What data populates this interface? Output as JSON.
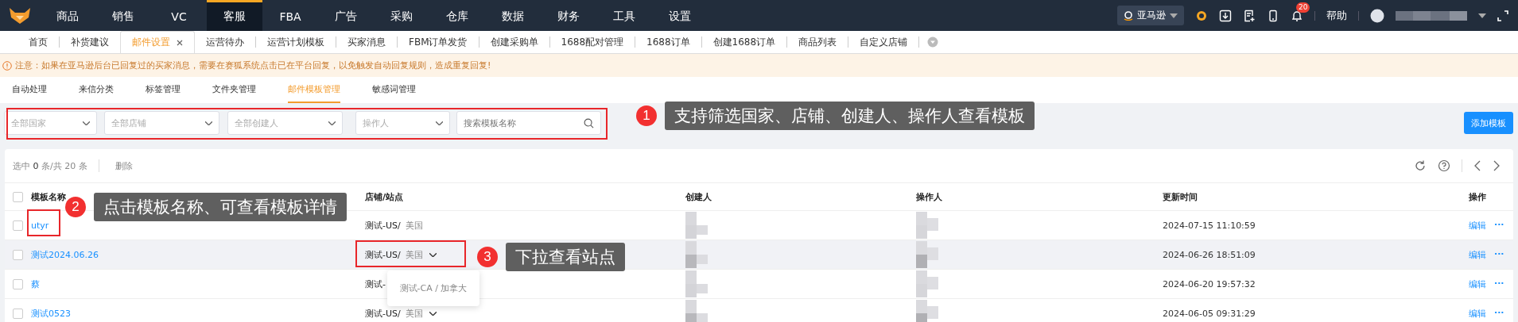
{
  "top_nav": {
    "items": [
      {
        "label": "商品",
        "selected": false
      },
      {
        "label": "销售",
        "selected": false
      },
      {
        "label": "VC",
        "selected": false
      },
      {
        "label": "客服",
        "selected": true
      },
      {
        "label": "FBA",
        "selected": false
      },
      {
        "label": "广告",
        "selected": false
      },
      {
        "label": "采购",
        "selected": false
      },
      {
        "label": "仓库",
        "selected": false
      },
      {
        "label": "数据",
        "selected": false
      },
      {
        "label": "财务",
        "selected": false
      },
      {
        "label": "工具",
        "selected": false
      },
      {
        "label": "设置",
        "selected": false
      }
    ],
    "platform": "亚马逊",
    "badge": "20",
    "help": "帮助"
  },
  "tabs": [
    {
      "label": "首页",
      "selected": false
    },
    {
      "label": "补货建议",
      "selected": false
    },
    {
      "label": "邮件设置",
      "selected": true
    },
    {
      "label": "运营待办",
      "selected": false
    },
    {
      "label": "运营计划模板",
      "selected": false
    },
    {
      "label": "买家消息",
      "selected": false
    },
    {
      "label": "FBM订单发货",
      "selected": false
    },
    {
      "label": "创建采购单",
      "selected": false
    },
    {
      "label": "1688配对管理",
      "selected": false
    },
    {
      "label": "1688订单",
      "selected": false
    },
    {
      "label": "创建1688订单",
      "selected": false
    },
    {
      "label": "商品列表",
      "selected": false
    },
    {
      "label": "自定义店铺",
      "selected": false
    }
  ],
  "notice": "注意：如果在亚马逊后台已回复过的买家消息，需要在赛狐系统点击已在平台回复，以免触发自动回复规则，造成重复回复!",
  "sub_tabs": [
    {
      "label": "自动处理",
      "selected": false
    },
    {
      "label": "来信分类",
      "selected": false
    },
    {
      "label": "标签管理",
      "selected": false
    },
    {
      "label": "文件夹管理",
      "selected": false
    },
    {
      "label": "邮件模板管理",
      "selected": true
    },
    {
      "label": "敏感词管理",
      "selected": false
    }
  ],
  "filters": [
    {
      "placeholder": "全部国家"
    },
    {
      "placeholder": "全部店铺"
    },
    {
      "placeholder": "全部创建人"
    },
    {
      "placeholder": "操作人"
    }
  ],
  "search": {
    "placeholder": "搜索模板名称"
  },
  "add_button": "添加模板",
  "toolbar": {
    "selected_prefix": "选中",
    "selected_count": "0",
    "selected_mid": "条/共",
    "total": "20",
    "selected_suffix": "条",
    "delete": "删除"
  },
  "table": {
    "all_checked": false,
    "columns": [
      "模板名称",
      "店铺/站点",
      "创建人",
      "操作人",
      "更新时间",
      "操作"
    ],
    "rows": [
      {
        "name": "utyr",
        "store": "测试-US",
        "sep": "/",
        "site": "美国",
        "dropdown": false,
        "time": "2024-07-15 11:10:59",
        "edit": "编辑",
        "more": "···",
        "checked": false,
        "selected": false
      },
      {
        "name": "测试2024.06.26",
        "store": "测试-US",
        "sep": "/",
        "site": "美国",
        "dropdown": true,
        "time": "2024-06-26 18:51:09",
        "edit": "编辑",
        "more": "···",
        "checked": false,
        "selected": true
      },
      {
        "name": "蔡",
        "store": "测试-",
        "dropdown": false,
        "time": "2024-06-20 19:57:32",
        "edit": "编辑",
        "more": "···",
        "checked": false,
        "selected": false
      },
      {
        "name": "测试0523",
        "store": "测试-US",
        "sep": "/",
        "site": "美国",
        "dropdown": true,
        "time": "2024-06-05 09:31:29",
        "edit": "编辑",
        "more": "···",
        "checked": false,
        "selected": false
      }
    ]
  },
  "dropdown_menu": {
    "store": "测试-CA",
    "sep": "/",
    "site": "加拿大"
  },
  "callouts": [
    {
      "number": "1",
      "text": "支持筛选国家、店铺、创建人、操作人查看模板"
    },
    {
      "number": "2",
      "text": "点击模板名称、可查看模板详情"
    },
    {
      "number": "3",
      "text": "下拉查看站点"
    }
  ]
}
